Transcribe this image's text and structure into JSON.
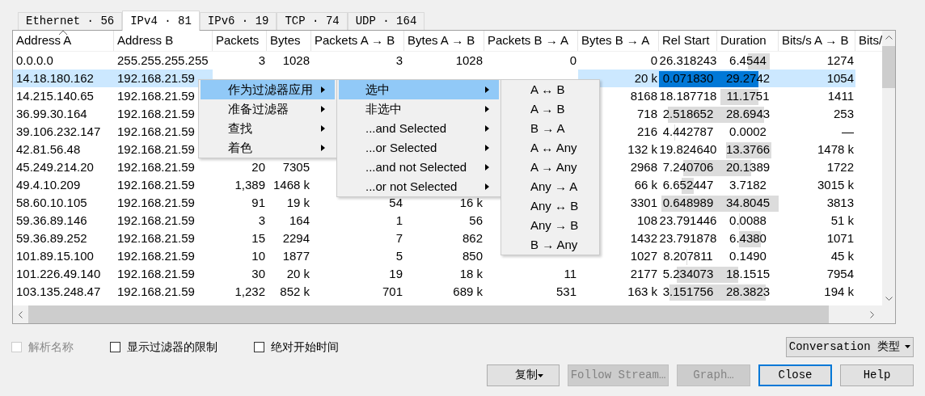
{
  "tabs": [
    {
      "label": "Ethernet · 56",
      "selected": false
    },
    {
      "label": "IPv4 · 81",
      "selected": true
    },
    {
      "label": "IPv6 · 19",
      "selected": false
    },
    {
      "label": "TCP · 74",
      "selected": false
    },
    {
      "label": "UDP · 164",
      "selected": false
    }
  ],
  "table": {
    "columns": [
      {
        "label": "Address A",
        "sorted": true
      },
      {
        "label": "Address B",
        "sorted": false
      },
      {
        "label": "Packets",
        "sorted": false
      },
      {
        "label": "Bytes",
        "sorted": false
      },
      {
        "label": "Packets A → B",
        "sorted": false
      },
      {
        "label": "Bytes A → B",
        "sorted": false
      },
      {
        "label": "Packets B → A",
        "sorted": false
      },
      {
        "label": "Bytes B → A",
        "sorted": false
      },
      {
        "label": "Rel Start",
        "sorted": false
      },
      {
        "label": "Duration",
        "sorted": false
      },
      {
        "label": "Bits/s A → B",
        "sorted": false
      },
      {
        "label": "Bits/",
        "sorted": false
      }
    ],
    "rows": [
      {
        "selected": false,
        "cells": [
          "0.0.0.0",
          "255.255.255.255",
          "3",
          "1028",
          "3",
          "1028",
          "0",
          "0",
          "26.318243",
          "6.4544",
          "1274"
        ]
      },
      {
        "selected": true,
        "cells": [
          "14.18.180.162",
          "192.168.21.59",
          null,
          null,
          null,
          null,
          null,
          "20 k",
          "0.071830",
          "29.2742",
          "1054"
        ]
      },
      {
        "selected": false,
        "cells": [
          "14.215.140.65",
          "192.168.21.59",
          null,
          null,
          null,
          null,
          null,
          "8168",
          "18.187718",
          "11.1751",
          "1411"
        ]
      },
      {
        "selected": false,
        "cells": [
          "36.99.30.164",
          "192.168.21.59",
          null,
          null,
          null,
          null,
          null,
          "718",
          "2.518652",
          "28.6943",
          "253"
        ]
      },
      {
        "selected": false,
        "cells": [
          "39.106.232.147",
          "192.168.21.59",
          null,
          null,
          null,
          null,
          null,
          "216",
          "4.442787",
          "0.0002",
          "—"
        ]
      },
      {
        "selected": false,
        "cells": [
          "42.81.56.48",
          "192.168.21.59",
          null,
          null,
          null,
          null,
          null,
          "132 k",
          "19.824640",
          "13.3766",
          "1478 k"
        ]
      },
      {
        "selected": false,
        "cells": [
          "45.249.214.20",
          "192.168.21.59",
          "20",
          "7305",
          null,
          null,
          null,
          "2968",
          "7.240706",
          "20.1389",
          "1722"
        ]
      },
      {
        "selected": false,
        "cells": [
          "49.4.10.209",
          "192.168.21.59",
          "1,389",
          "1468 k",
          null,
          null,
          null,
          "66 k",
          "6.652447",
          "3.7182",
          "3015 k"
        ]
      },
      {
        "selected": false,
        "cells": [
          "58.60.10.105",
          "192.168.21.59",
          "91",
          "19 k",
          "54",
          "16 k",
          null,
          "3301",
          "0.648989",
          "34.8045",
          "3813"
        ]
      },
      {
        "selected": false,
        "cells": [
          "59.36.89.146",
          "192.168.21.59",
          "3",
          "164",
          "1",
          "56",
          null,
          "108",
          "23.791446",
          "0.0088",
          "51 k"
        ]
      },
      {
        "selected": false,
        "cells": [
          "59.36.89.252",
          "192.168.21.59",
          "15",
          "2294",
          "7",
          "862",
          null,
          "1432",
          "23.791878",
          "6.4380",
          "1071"
        ]
      },
      {
        "selected": false,
        "cells": [
          "101.89.15.100",
          "192.168.21.59",
          "10",
          "1877",
          "5",
          "850",
          null,
          "1027",
          "8.207811",
          "0.1490",
          "45 k"
        ]
      },
      {
        "selected": false,
        "cells": [
          "101.226.49.140",
          "192.168.21.59",
          "30",
          "20 k",
          "19",
          "18 k",
          "11",
          "2177",
          "5.234073",
          "18.1515",
          "7954"
        ]
      },
      {
        "selected": false,
        "cells": [
          "103.135.248.47",
          "192.168.21.59",
          "1,232",
          "852 k",
          "701",
          "689 k",
          "531",
          "163 k",
          "3.151756",
          "28.3823",
          "194 k"
        ]
      }
    ]
  },
  "context_menu": {
    "items": [
      {
        "label": "作为过滤器应用",
        "selected": true,
        "submenu": true
      },
      {
        "label": "准备过滤器",
        "selected": false,
        "submenu": true
      },
      {
        "label": "查找",
        "selected": false,
        "submenu": true
      },
      {
        "label": "着色",
        "selected": false,
        "submenu": true
      }
    ],
    "submenu": {
      "items": [
        {
          "label": "选中",
          "selected": true,
          "submenu": true
        },
        {
          "label": "非选中",
          "selected": false,
          "submenu": true
        },
        {
          "label": "...and Selected",
          "selected": false,
          "submenu": true
        },
        {
          "label": "...or Selected",
          "selected": false,
          "submenu": true
        },
        {
          "label": "...and not Selected",
          "selected": false,
          "submenu": true
        },
        {
          "label": "...or not Selected",
          "selected": false,
          "submenu": true
        }
      ],
      "submenu": {
        "items": [
          {
            "label": "A ↔ B",
            "selected": false,
            "submenu": false
          },
          {
            "label": "A → B",
            "selected": false,
            "submenu": false
          },
          {
            "label": "B → A",
            "selected": false,
            "submenu": false
          },
          {
            "label": "A ↔ Any",
            "selected": false,
            "submenu": false
          },
          {
            "label": "A → Any",
            "selected": false,
            "submenu": false
          },
          {
            "label": "Any → A",
            "selected": false,
            "submenu": false
          },
          {
            "label": "Any ↔ B",
            "selected": false,
            "submenu": false
          },
          {
            "label": "Any → B",
            "selected": false,
            "submenu": false
          },
          {
            "label": "B → Any",
            "selected": false,
            "submenu": false
          }
        ]
      }
    }
  },
  "options": [
    {
      "label": "解析名称",
      "checked": false,
      "disabled": true
    },
    {
      "label": "显示过滤器的限制",
      "checked": false,
      "disabled": false
    },
    {
      "label": "绝对开始时间",
      "checked": false,
      "disabled": false
    }
  ],
  "type_dropdown": {
    "label": "Conversation 类型"
  },
  "buttons": [
    {
      "label": "复制",
      "disabled": false,
      "focused": false,
      "dropdown": true
    },
    {
      "label": "Follow Stream…",
      "disabled": true,
      "focused": false,
      "dropdown": false
    },
    {
      "label": "Graph…",
      "disabled": true,
      "focused": false,
      "dropdown": false
    },
    {
      "label": "Close",
      "disabled": false,
      "focused": true,
      "dropdown": false
    },
    {
      "label": "Help",
      "disabled": false,
      "focused": false,
      "dropdown": false
    }
  ]
}
